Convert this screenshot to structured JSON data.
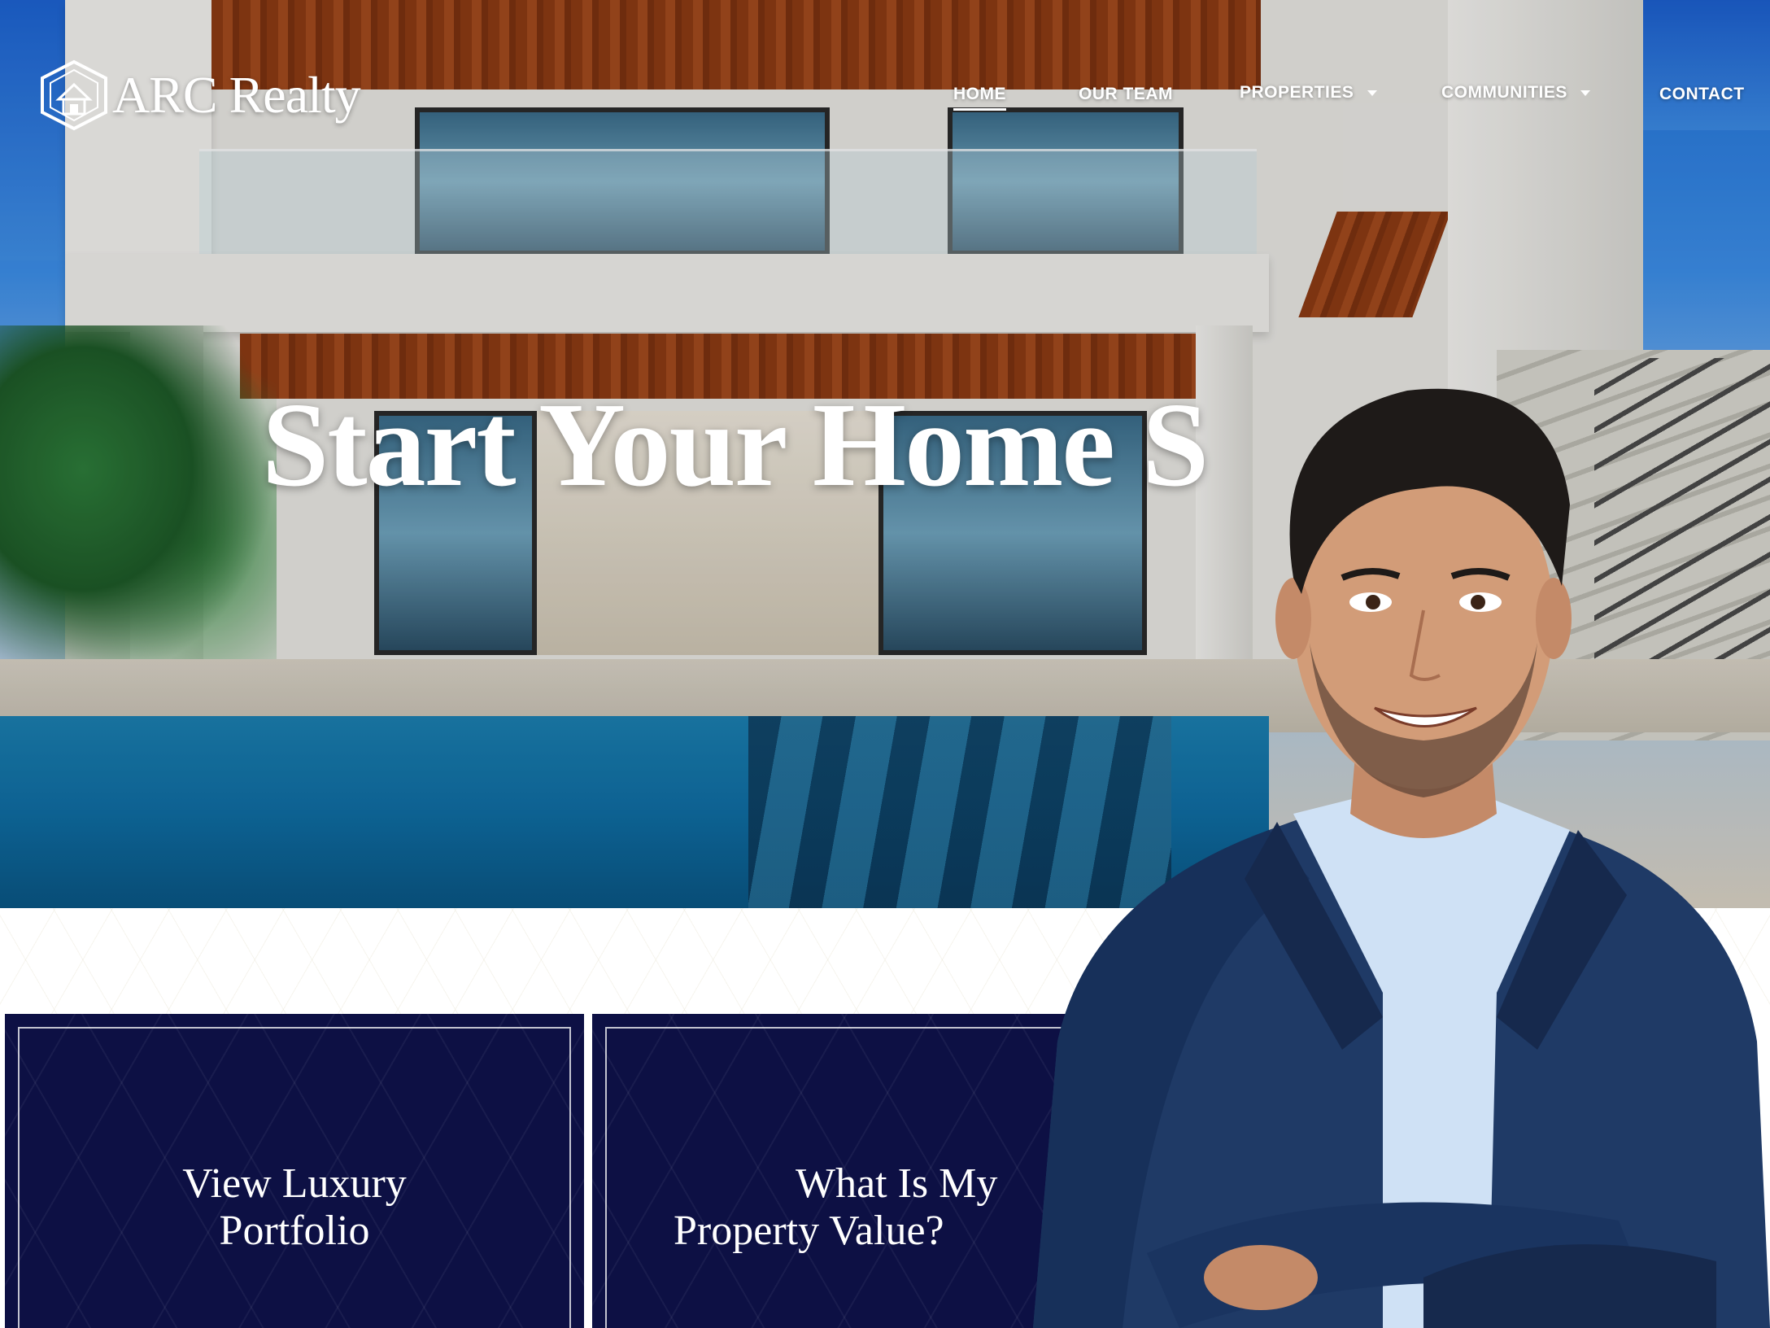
{
  "brand": {
    "name": "ARC Realty"
  },
  "nav": {
    "items": [
      {
        "label": "HOME",
        "active": true,
        "dropdown": false
      },
      {
        "label": "OUR TEAM",
        "active": false,
        "dropdown": false
      },
      {
        "label": "PROPERTIES",
        "active": false,
        "dropdown": true
      },
      {
        "label": "COMMUNITIES",
        "active": false,
        "dropdown": true
      },
      {
        "label": "CONTACT",
        "active": false,
        "dropdown": false
      }
    ]
  },
  "hero": {
    "headline": "Start Your Home S"
  },
  "cards": [
    {
      "line1": "View Luxury",
      "line2": "Portfolio"
    },
    {
      "line1": "What Is My",
      "line2": "Property Value?"
    }
  ],
  "colors": {
    "navy": "#0d1044",
    "white": "#ffffff",
    "suit": "#1f3a66",
    "shirt": "#cfe1f5"
  },
  "icons": {
    "logo": "house-hexagon-icon",
    "dropdown": "caret-down-icon"
  }
}
